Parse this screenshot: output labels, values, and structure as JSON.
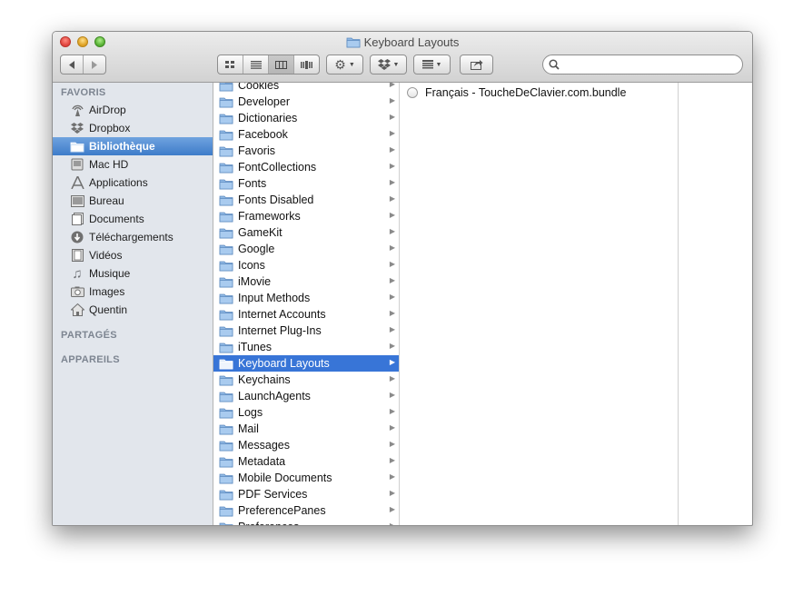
{
  "window": {
    "title": "Keyboard Layouts"
  },
  "sidebar": {
    "sections": {
      "favorites": "FAVORIS",
      "shared": "PARTAGÉS",
      "devices": "APPAREILS"
    },
    "items": [
      {
        "label": "AirDrop",
        "icon": "airdrop-icon"
      },
      {
        "label": "Dropbox",
        "icon": "dropbox-icon"
      },
      {
        "label": "Bibliothèque",
        "icon": "folder-icon",
        "selected": true
      },
      {
        "label": "Mac HD",
        "icon": "harddrive-icon"
      },
      {
        "label": "Applications",
        "icon": "applications-icon"
      },
      {
        "label": "Bureau",
        "icon": "desktop-icon"
      },
      {
        "label": "Documents",
        "icon": "documents-icon"
      },
      {
        "label": "Téléchargements",
        "icon": "downloads-icon"
      },
      {
        "label": "Vidéos",
        "icon": "movies-icon"
      },
      {
        "label": "Musique",
        "icon": "music-icon"
      },
      {
        "label": "Images",
        "icon": "pictures-icon"
      },
      {
        "label": "Quentin",
        "icon": "home-icon"
      }
    ]
  },
  "columns": {
    "library": [
      "Cookies",
      "Developer",
      "Dictionaries",
      "Facebook",
      "Favoris",
      "FontCollections",
      "Fonts",
      "Fonts Disabled",
      "Frameworks",
      "GameKit",
      "Google",
      "Icons",
      "iMovie",
      "Input Methods",
      "Internet Accounts",
      "Internet Plug-Ins",
      "iTunes",
      "Keyboard Layouts",
      "Keychains",
      "LaunchAgents",
      "Logs",
      "Mail",
      "Messages",
      "Metadata",
      "Mobile Documents",
      "PDF Services",
      "PreferencePanes",
      "Preferences"
    ],
    "library_selected": "Keyboard Layouts",
    "keyboard_layouts": [
      "Français - ToucheDeClavier.com.bundle"
    ]
  },
  "colors": {
    "selection": "#3875d7",
    "sidebar_bg": "#e2e6ec"
  }
}
